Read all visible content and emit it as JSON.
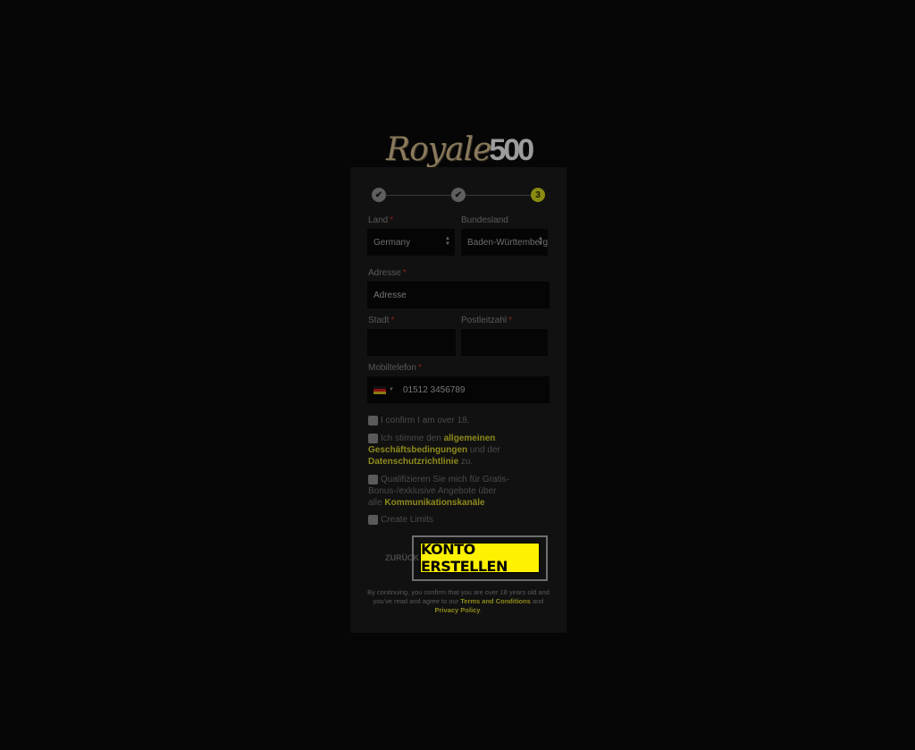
{
  "logo": {
    "script": "Royale",
    "number": "500"
  },
  "steps": [
    {
      "glyph": "✔",
      "state": "done"
    },
    {
      "glyph": "✔",
      "state": "done"
    },
    {
      "glyph": "3",
      "state": "current"
    }
  ],
  "form": {
    "land": {
      "label": "Land",
      "required": "*",
      "value": "Germany"
    },
    "bundesland": {
      "label": "Bundesland",
      "value": "Baden-Württemberg"
    },
    "adresse": {
      "label": "Adresse",
      "required": "*",
      "placeholder": "Adresse"
    },
    "stadt": {
      "label": "Stadt",
      "required": "*",
      "value": ""
    },
    "postleitzahl": {
      "label": "Postleitzahl",
      "required": "*",
      "value": ""
    },
    "mobiltelefon": {
      "label": "Mobiltelefon",
      "required": "*",
      "value": "01512 3456789",
      "country_flag": "germany-flag-icon"
    }
  },
  "checkboxes": {
    "age": {
      "text": "I confirm I am over 18."
    },
    "terms": {
      "pre": "Ich stimme den ",
      "link1": "allgemeinen Geschäftsbedingungen",
      "mid": " und der ",
      "link2": "Datenschutzrichtlinie",
      "post": " zu."
    },
    "bonus": {
      "pre": "Qualifizieren Sie mich für Gratis-Bonus-/exklusive Angebote über alle ",
      "link": "Kommunikationskanäle"
    },
    "limits": {
      "text": "Create Limits"
    }
  },
  "actions": {
    "back_label": "ZURÜCK",
    "submit_label": "KONTO ERSTELLEN"
  },
  "legal": {
    "pre": "By continuing, you confirm that you are over 18 years old and you've read and agree to our ",
    "terms_link": "Terms and Conditions",
    "and": " and ",
    "privacy_link": "Privacy Policy",
    "end": "."
  },
  "colors": {
    "accent": "#fff200",
    "link": "#8e8a1c",
    "background": "#060606",
    "card": "#111111"
  }
}
